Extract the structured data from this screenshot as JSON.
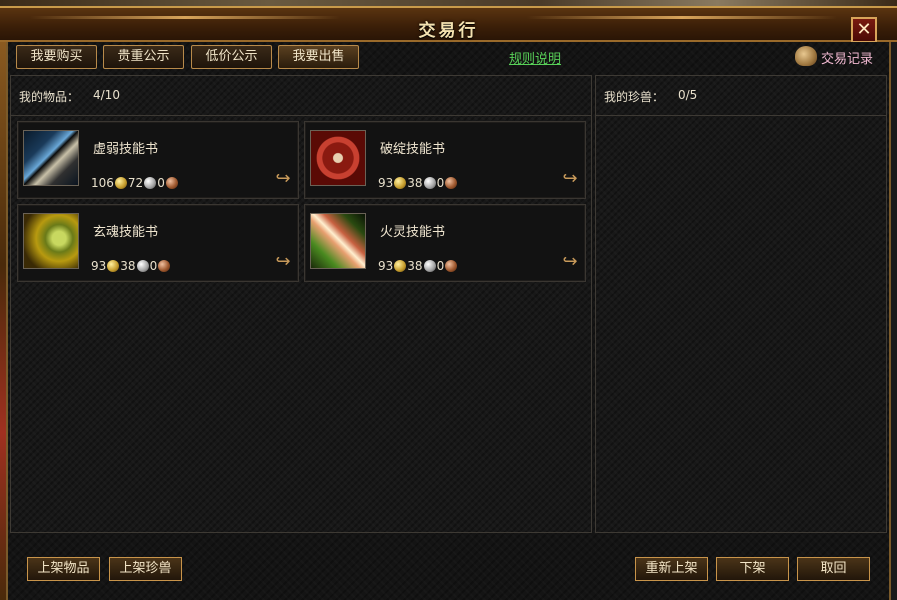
{
  "window": {
    "title": "交易行",
    "close_symbol": "✕"
  },
  "tabs": [
    {
      "label": "我要购买"
    },
    {
      "label": "贵重公示"
    },
    {
      "label": "低价公示"
    },
    {
      "label": "我要出售"
    }
  ],
  "rules_link": "规则说明",
  "trade_record": {
    "label": "交易记录",
    "icon": "scroll-icon"
  },
  "my_items": {
    "label": "我的物品：",
    "count": "4/10",
    "items": [
      {
        "name": "虚弱技能书",
        "gold": "106",
        "silver": "72",
        "copper": "0",
        "icon": "blade-icon"
      },
      {
        "name": "破绽技能书",
        "gold": "93",
        "silver": "38",
        "copper": "0",
        "icon": "red-seal-icon"
      },
      {
        "name": "玄魂技能书",
        "gold": "93",
        "silver": "38",
        "copper": "0",
        "icon": "spirit-icon"
      },
      {
        "name": "火灵技能书",
        "gold": "93",
        "silver": "38",
        "copper": "0",
        "icon": "crystal-icon"
      }
    ]
  },
  "my_pets": {
    "label": "我的珍兽：",
    "count": "0/5"
  },
  "buttons": {
    "list_item": "上架物品",
    "list_pet": "上架珍兽",
    "relist": "重新上架",
    "delist": "下架",
    "withdraw": "取回"
  },
  "colors": {
    "link": "#58d058",
    "record": "#f0b8d0",
    "border_gold": "#c8944a"
  }
}
